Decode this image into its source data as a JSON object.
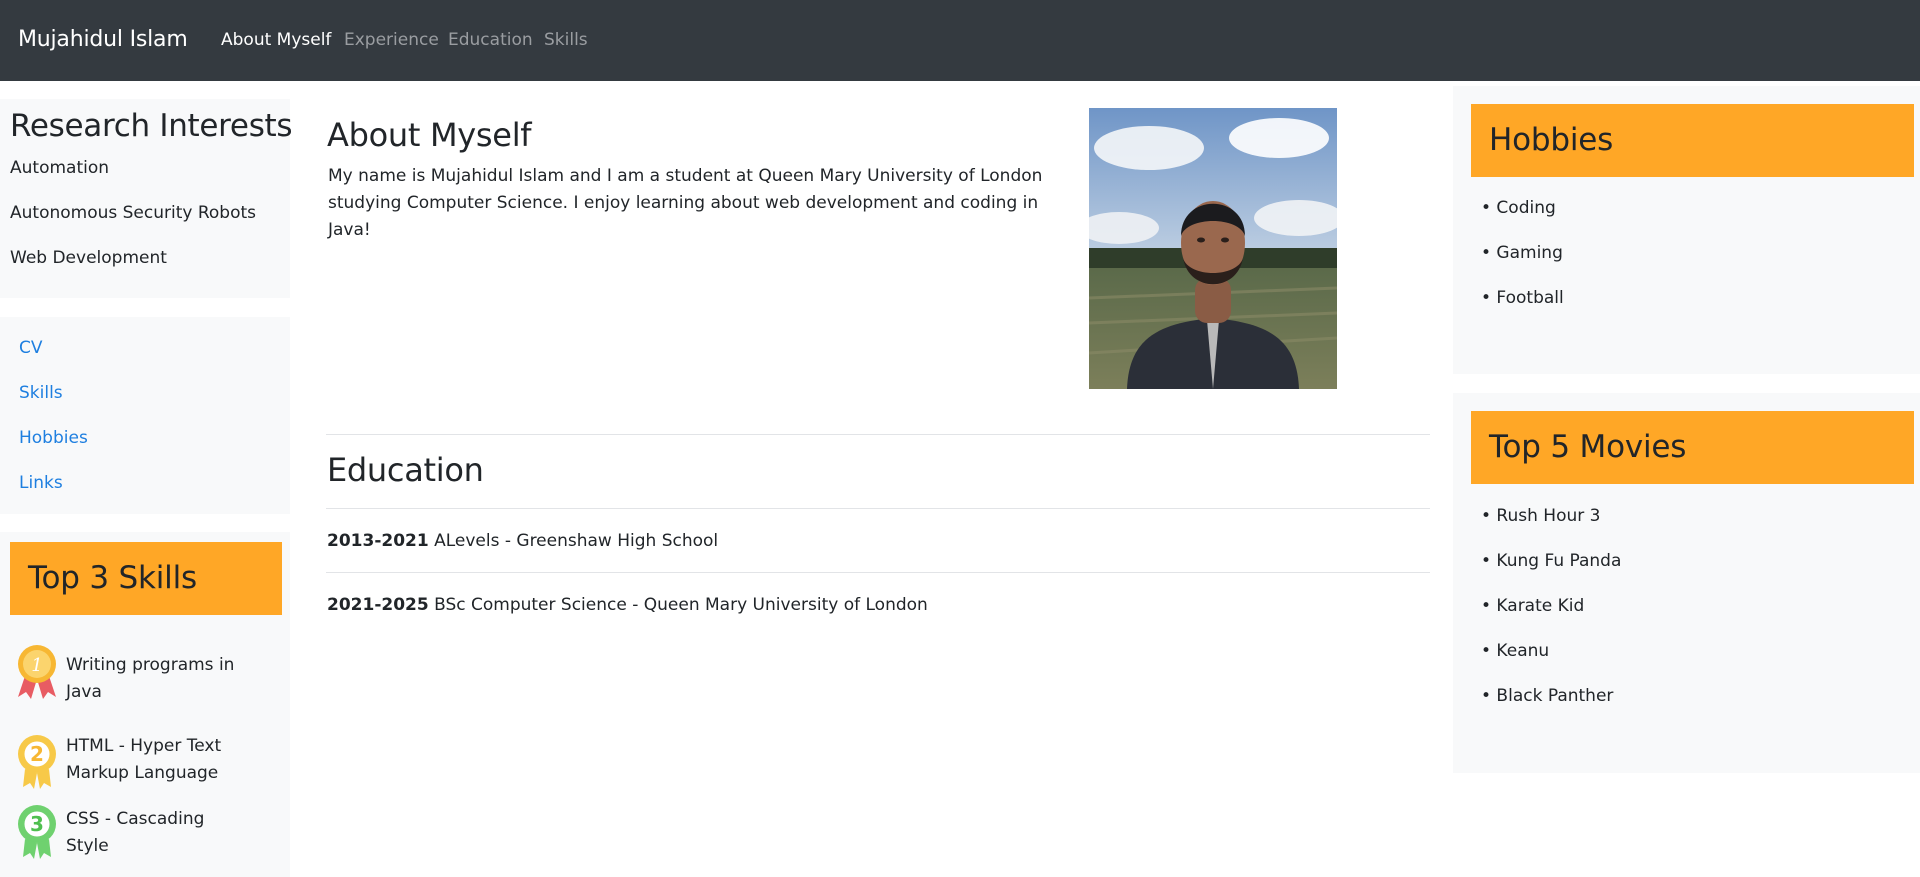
{
  "nav": {
    "brand": "Mujahidul Islam",
    "links": [
      "About Myself",
      "Experience",
      "Education",
      "Skills"
    ]
  },
  "research": {
    "title": "Research Interests",
    "items": [
      "Automation",
      "Autonomous Security Robots",
      "Web Development"
    ]
  },
  "quick_links": [
    "CV",
    "Skills",
    "Hobbies",
    "Links"
  ],
  "top_skills": {
    "title": "Top 3 Skills",
    "items": [
      {
        "rank": "1",
        "text": "Writing programs in Java"
      },
      {
        "rank": "2",
        "text": "HTML - Hyper Text Markup Language"
      },
      {
        "rank": "3",
        "text": "CSS - Cascading Style"
      }
    ]
  },
  "about": {
    "title": "About Myself",
    "text": "My name is Mujahidul Islam and I am a student at Queen Mary University of London studying Computer Science. I enjoy learning about web development and coding in Java!"
  },
  "education": {
    "title": "Education",
    "rows": [
      {
        "years": "2013-2021",
        "detail": "ALevels - Greenshaw High School"
      },
      {
        "years": "2021-2025",
        "detail": "BSc Computer Science - Queen Mary University of London"
      }
    ]
  },
  "hobbies": {
    "title": "Hobbies",
    "items": [
      "• Coding",
      "• Gaming",
      "• Football"
    ]
  },
  "movies": {
    "title": "Top 5 Movies",
    "items": [
      "• Rush Hour 3",
      "• Kung Fu Panda",
      "• Karate Kid",
      "• Keanu",
      "• Black Panther"
    ]
  },
  "colors": {
    "navbar": "#343a40",
    "accent": "#ffa726",
    "link": "#1e7fe0",
    "panel": "#f8f9fa"
  }
}
